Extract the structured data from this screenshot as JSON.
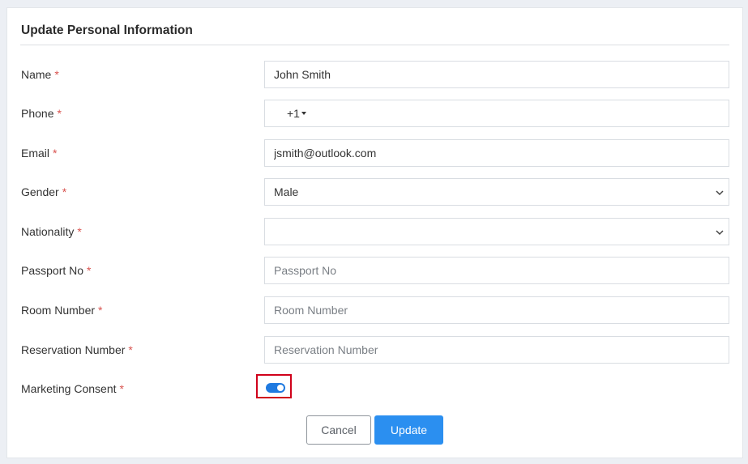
{
  "form": {
    "title": "Update Personal Information",
    "required_mark": "*",
    "fields": {
      "name": {
        "label": "Name",
        "value": "John Smith"
      },
      "phone": {
        "label": "Phone",
        "code": "+1",
        "value": ""
      },
      "email": {
        "label": "Email",
        "value": "jsmith@outlook.com"
      },
      "gender": {
        "label": "Gender",
        "selected": "Male"
      },
      "nationality": {
        "label": "Nationality",
        "selected": ""
      },
      "passport": {
        "label": "Passport No",
        "placeholder": "Passport No",
        "value": ""
      },
      "room": {
        "label": "Room Number",
        "placeholder": "Room Number",
        "value": ""
      },
      "reservation": {
        "label": "Reservation Number",
        "placeholder": "Reservation Number",
        "value": ""
      },
      "marketing": {
        "label": "Marketing Consent",
        "enabled": true
      }
    },
    "buttons": {
      "cancel": "Cancel",
      "update": "Update"
    },
    "colors": {
      "accent": "#2b8ff0",
      "toggle_on": "#1f7ae0",
      "required": "#d9534f",
      "highlight": "#d0021b"
    }
  }
}
